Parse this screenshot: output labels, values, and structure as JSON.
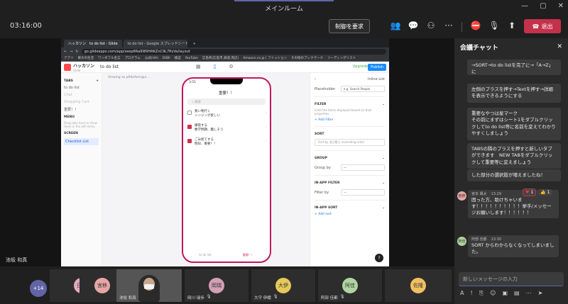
{
  "window": {
    "title": "メインルーム"
  },
  "toolbar": {
    "timer": "03:16:00",
    "control_label": "制御を要求",
    "leave_label": "退出"
  },
  "share": {
    "presenter_name": "池坂 和真"
  },
  "browser": {
    "tabs": [
      "ハッカソン　to do list - Glide",
      "to do list - Google スプレッドシート",
      "+"
    ],
    "url": "go.glideapps.com/app/seep6Ra9W9HAKZnC9L7Ri/ds/layout",
    "bookmarks": [
      "アプリ",
      "東大の生活",
      "ワンダフル名言",
      "プログラム",
      "公式(HA)",
      "DSBI",
      "検証",
      "YouTube",
      "広島県(広島市,鉄道,周辺)",
      "Amazon.co.jp | ファッション",
      "その他のブックマーク",
      "リーディングリスト"
    ]
  },
  "glide": {
    "app_name": "ハッカソン",
    "app_sub": "Glide",
    "page_name": "to do list",
    "upgrade": "Upgrade",
    "publish": "Publish",
    "left": {
      "tabs_header": "TABS",
      "items": [
        {
          "label": "to do list",
          "dim": false
        },
        {
          "label": "Chat",
          "dim": true
        },
        {
          "label": "Shopping Cart",
          "dim": true
        },
        {
          "label": "重要！！",
          "dim": false
        }
      ],
      "menu_header": "MENU",
      "menu_note": "Drag tabs here to show them in the left menu",
      "screen_header": "SCREEN",
      "screen_item": "Checklist List"
    },
    "viewing": "Viewing as p00eAvm@a...",
    "phone": {
      "time": "3:51",
      "title": "重要！！",
      "search_placeholder": "検索",
      "items": [
        {
          "text": "買い物行く\nニンジンが欲しい",
          "checked": false
        },
        {
          "text": "徹夜する\n数学問題、難しそう",
          "checked": true
        },
        {
          "text": "ごみ捨てする\n明日、重要！！",
          "checked": true
        }
      ],
      "nav": [
        "to do list",
        "重要！！"
      ]
    },
    "right": {
      "placeholder_label": "Placeholder",
      "placeholder_value": "e.g. Search People",
      "filter_header": "FILTER",
      "filter_desc": "Limit the items displayed based on their properties",
      "add_filter": "+ Add Filter",
      "sort_header": "SORT",
      "sort_value": "Sort by 並び替え ascending order",
      "group_header": "GROUP",
      "group_by": "Group by",
      "group_value": "—",
      "inapp_filter_header": "IN-APP FILTER",
      "filter_by": "Filter by",
      "filter_value": "—",
      "inapp_sort_header": "IN-APP SORT",
      "add_sort": "+ Add sort",
      "inline_list": "Inline List"
    }
  },
  "chat": {
    "title": "会議チャット",
    "bubbles": [
      "→SORT→to do listを完了に→「A→Z」に",
      "左側のプラスを押す→Textを押す→詳細を表示できるようにする",
      "重要なやつは星マーク\nその前にまずはシート1をダブルクリックしてto do list等に名前を変えてわかりやすくしましょう",
      "TABSの隣のプラスを押すと新しいタブができます　NEW TABをダブルクリックして重要等に変えましょう",
      "した部分の選択肢が増えましたね！"
    ],
    "messages": [
      {
        "avatar": "宮移",
        "author": "宮本 颯太",
        "time": "13:29",
        "text": "困った方、助けちゃいます！！！！！！！！！！挙手/メッセージお願いします！！！！！！",
        "reactions": [
          {
            "icon": "♥",
            "count": "1"
          },
          {
            "icon": "👍",
            "count": "1"
          }
        ]
      },
      {
        "avatar": "阿佳",
        "author": "阿部 佳都",
        "time": "13:30",
        "text": "SORT からわからなくなってしまいました。"
      }
    ],
    "input_placeholder": "新しいメッセージの入力"
  },
  "gallery": {
    "overflow": "+14",
    "tiles": [
      {
        "initials": "日公",
        "color": "#e3a9b9",
        "name": ""
      },
      {
        "initials": "宮移",
        "color": "#e8a5a5",
        "name": ""
      },
      {
        "initials": "",
        "color": "",
        "name": "池坂 和真",
        "camera": true
      },
      {
        "initials": "岡瑞",
        "color": "#d4a0b5",
        "name": "岡川 瑞歩"
      },
      {
        "initials": "大伊",
        "color": "#e6c85a",
        "name": "大守 伊織"
      },
      {
        "initials": "阿佳",
        "color": "#b0d4a0",
        "name": "阿部 佳都"
      },
      {
        "initials": "佐隆",
        "color": "#f0c060",
        "name": ""
      }
    ]
  }
}
